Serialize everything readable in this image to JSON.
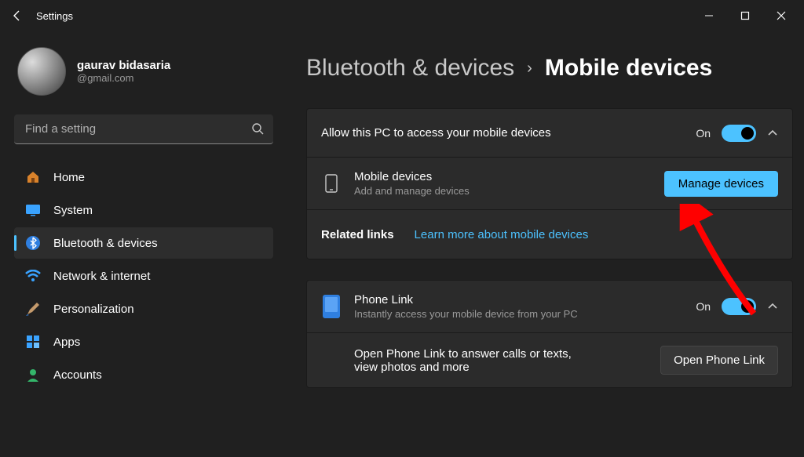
{
  "window": {
    "title": "Settings"
  },
  "user": {
    "name": "gaurav bidasaria",
    "email": "@gmail.com"
  },
  "search": {
    "placeholder": "Find a setting"
  },
  "nav": {
    "items": [
      {
        "label": "Home"
      },
      {
        "label": "System"
      },
      {
        "label": "Bluetooth & devices"
      },
      {
        "label": "Network & internet"
      },
      {
        "label": "Personalization"
      },
      {
        "label": "Apps"
      },
      {
        "label": "Accounts"
      }
    ]
  },
  "breadcrumb": {
    "parent": "Bluetooth & devices",
    "current": "Mobile devices"
  },
  "section1": {
    "allow": {
      "title": "Allow this PC to access your mobile devices",
      "status": "On"
    },
    "mobile": {
      "title": "Mobile devices",
      "sub": "Add and manage devices",
      "button": "Manage devices"
    },
    "related": {
      "label": "Related links",
      "link": "Learn more about mobile devices"
    }
  },
  "section2": {
    "phonelink": {
      "title": "Phone Link",
      "sub": "Instantly access your mobile device from your PC",
      "status": "On"
    },
    "open": {
      "text": "Open Phone Link to answer calls or texts, view photos and more",
      "button": "Open Phone Link"
    }
  }
}
